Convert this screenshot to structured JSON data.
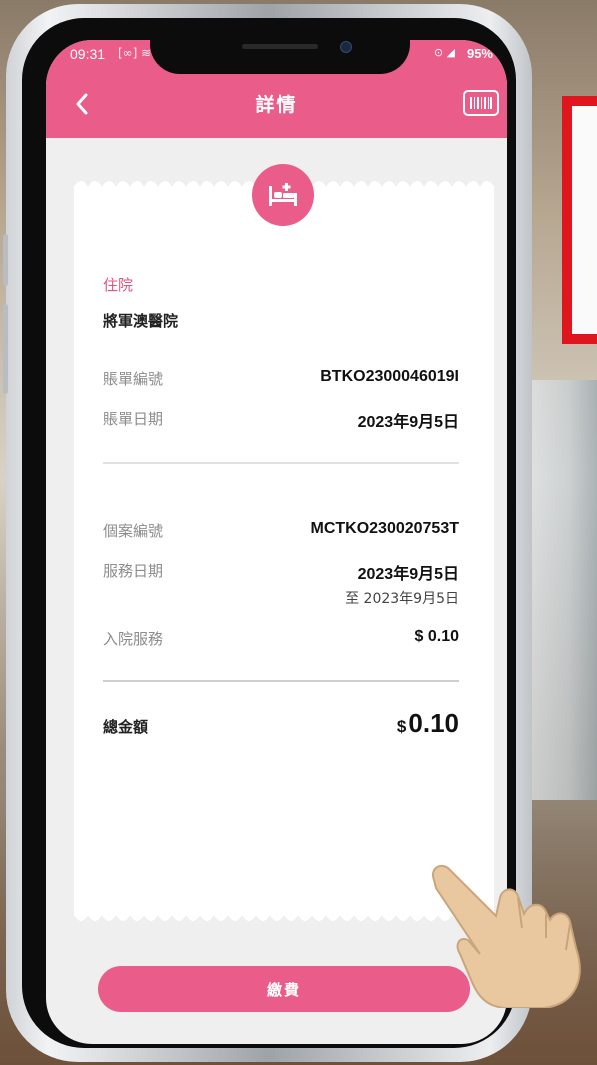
{
  "status_bar": {
    "time": "09:31",
    "cast_indicator": "[∞] ≋",
    "signal": "⊙ ◢",
    "battery": "95%"
  },
  "header": {
    "title": "詳情",
    "back_icon": "chevron-left-icon",
    "barcode_icon": "barcode-icon"
  },
  "receipt": {
    "type_icon": "hospital-bed-icon",
    "category": "住院",
    "hospital": "將軍澳醫院",
    "bill_number": {
      "label": "賬單編號",
      "value": "BTKO2300046019I"
    },
    "bill_date": {
      "label": "賬單日期",
      "value": "2023年9月5日"
    },
    "case_number": {
      "label": "個案編號",
      "value": "MCTKO230020753T"
    },
    "service_date": {
      "label": "服務日期",
      "value": "2023年9月5日",
      "value_to": "至 2023年9月5日"
    },
    "admission_service": {
      "label": "入院服務",
      "value": "$ 0.10"
    },
    "total": {
      "label": "總金額",
      "currency": "$",
      "amount": "0.10"
    }
  },
  "pay_button": {
    "label": "繳費"
  },
  "colors": {
    "accent": "#ea5c8a",
    "background": "#efefef",
    "frame_red": "#e0161e"
  }
}
